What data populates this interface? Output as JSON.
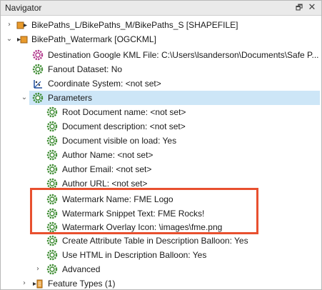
{
  "window": {
    "title": "Navigator",
    "pin_icon": "pin-icon",
    "close_icon": "close-icon"
  },
  "tree": {
    "items": [
      {
        "label": "BikePaths_L/BikePaths_M/BikePaths_S [SHAPEFILE]",
        "icon": "reader-icon",
        "expanded": false
      },
      {
        "label": "BikePath_Watermark [OGCKML]",
        "icon": "writer-icon",
        "expanded": true
      },
      {
        "label": "Destination Google KML File: C:\\Users\\lsanderson\\Documents\\Safe P...",
        "icon": "gear-icon"
      },
      {
        "label": "Fanout Dataset: No",
        "icon": "gear-icon"
      },
      {
        "label": "Coordinate System: <not set>",
        "icon": "coordinate-icon"
      },
      {
        "label": "Parameters",
        "icon": "gear-icon",
        "expanded": true,
        "selected": true
      },
      {
        "label": "Root Document name: <not set>",
        "icon": "gear-icon"
      },
      {
        "label": "Document description: <not set>",
        "icon": "gear-icon"
      },
      {
        "label": "Document visible on load: Yes",
        "icon": "gear-icon"
      },
      {
        "label": "Author Name: <not set>",
        "icon": "gear-icon"
      },
      {
        "label": "Author Email: <not set>",
        "icon": "gear-icon"
      },
      {
        "label": "Author URL: <not set>",
        "icon": "gear-icon"
      },
      {
        "label": "Watermark Name: FME Logo",
        "icon": "gear-icon"
      },
      {
        "label": "Watermark Snippet Text: FME Rocks!",
        "icon": "gear-icon"
      },
      {
        "label": "Watermark Overlay Icon: \\images\\fme.png",
        "icon": "gear-icon"
      },
      {
        "label": "Create Attribute Table in Description Balloon: Yes",
        "icon": "gear-icon"
      },
      {
        "label": "Use HTML in Description Balloon: Yes",
        "icon": "gear-icon"
      },
      {
        "label": "Advanced",
        "icon": "gear-icon",
        "expanded": false
      },
      {
        "label": "Feature Types (1)",
        "icon": "feature-types-icon",
        "expanded": false
      }
    ]
  },
  "colors": {
    "selection": "#cde6f7",
    "highlight_box": "#e8502f",
    "gear": "#3a8a2e",
    "reader": "#e89a2c"
  }
}
